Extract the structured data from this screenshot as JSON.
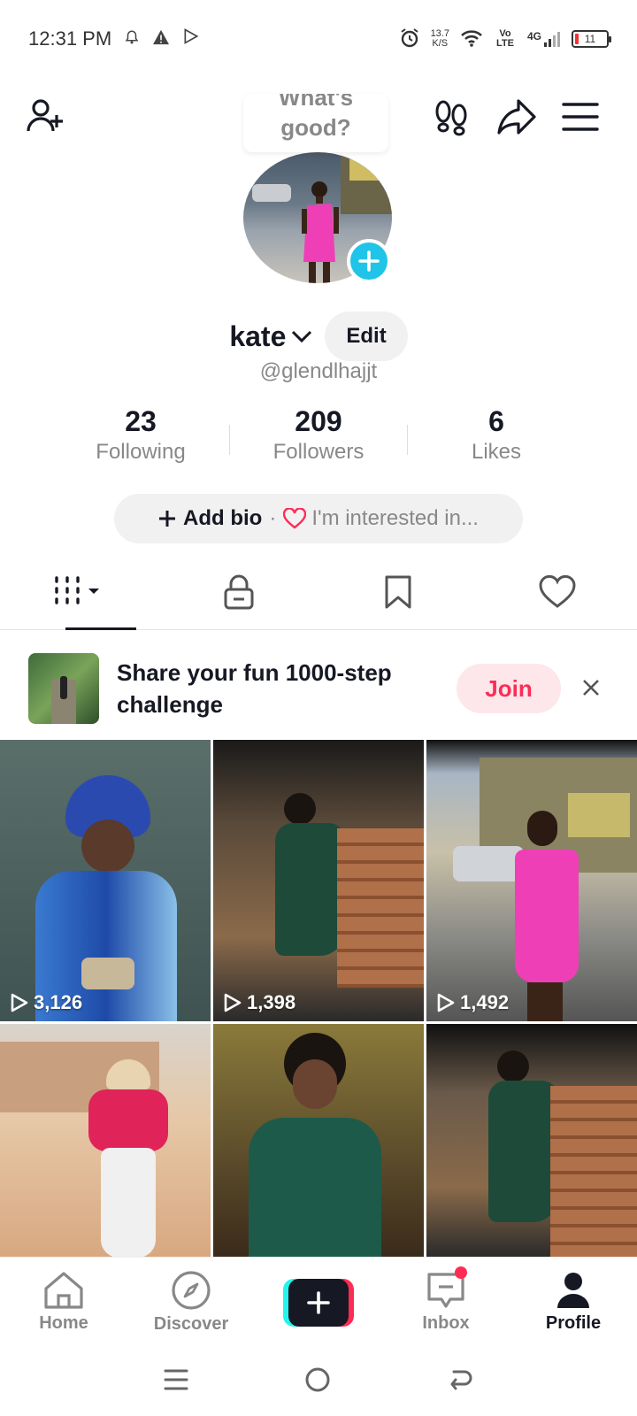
{
  "status_bar": {
    "time": "12:31 PM",
    "net_speed_value": "13.7",
    "net_speed_unit": "K/S",
    "volte": "Vo LTE",
    "network": "4G",
    "battery": "11"
  },
  "top_bar": {
    "bubble_text": "What's good?"
  },
  "profile": {
    "name": "kate",
    "edit_label": "Edit",
    "handle": "@glendlhajjt",
    "stats": [
      {
        "value": "23",
        "label": "Following"
      },
      {
        "value": "209",
        "label": "Followers"
      },
      {
        "value": "6",
        "label": "Likes"
      }
    ],
    "add_bio_label": "Add bio",
    "interest_label": "I'm interested in..."
  },
  "banner": {
    "text": "Share your fun 1000-step challenge",
    "join_label": "Join"
  },
  "videos": [
    {
      "views": "3,126"
    },
    {
      "views": "1,398"
    },
    {
      "views": "1,492"
    },
    {
      "views": ""
    },
    {
      "views": ""
    },
    {
      "views": ""
    }
  ],
  "bottom_nav": {
    "home": "Home",
    "discover": "Discover",
    "inbox": "Inbox",
    "profile": "Profile"
  },
  "colors": {
    "accent": "#fe2c55",
    "cyan": "#25f4ee",
    "avatar_plus": "#20c4e8"
  }
}
